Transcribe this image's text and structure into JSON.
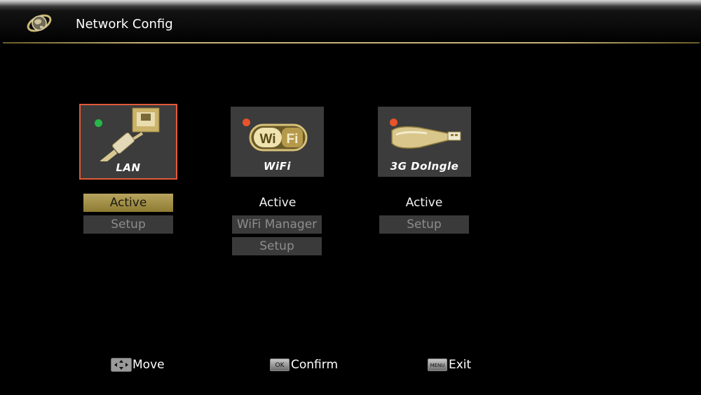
{
  "window": {
    "title": "Network Config"
  },
  "cards": [
    {
      "label": "LAN",
      "status": "green",
      "icon": "ethernet-cable-icon"
    },
    {
      "label": "WiFi",
      "status": "red",
      "icon": "wifi-logo-icon"
    },
    {
      "label": "3G Dolngle",
      "status": "red",
      "icon": "usb-dongle-icon"
    }
  ],
  "lan": {
    "active_label": "Active",
    "setup_label": "Setup"
  },
  "wifi": {
    "active_label": "Active",
    "manager_label": "WiFi Manager",
    "setup_label": "Setup"
  },
  "dongle": {
    "active_label": "Active",
    "setup_label": "Setup"
  },
  "footer": {
    "move_label": "Move",
    "confirm_label": "Confirm",
    "confirm_key": "OK",
    "exit_label": "Exit",
    "exit_key": "MENU"
  },
  "colors": {
    "selection_border": "#e05a3a",
    "focus_button": "#a8954a",
    "status_on": "#28b44a",
    "status_off": "#e8532b"
  }
}
